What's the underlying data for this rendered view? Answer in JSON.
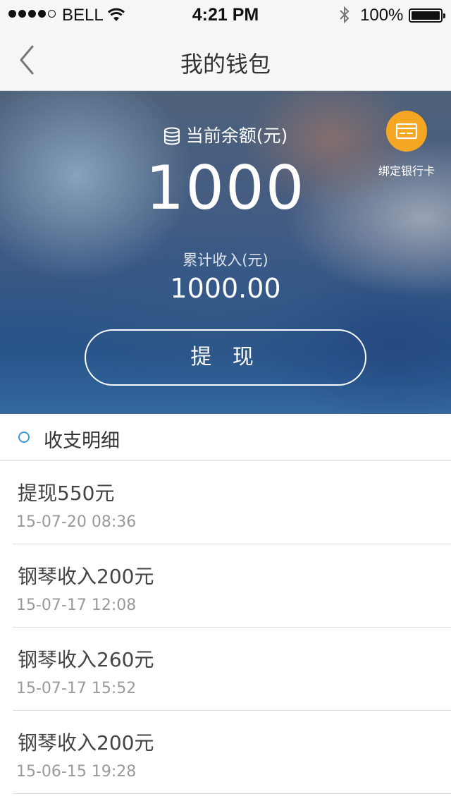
{
  "status_bar": {
    "carrier": "BELL",
    "time": "4:21 PM",
    "battery": "100%"
  },
  "nav": {
    "title": "我的钱包"
  },
  "wallet": {
    "balance_label": "当前余额(元)",
    "balance": "1000",
    "income_label": "累计收入(元)",
    "income": "1000.00",
    "withdraw_label": "提 现",
    "bind_card_label": "绑定银行卡",
    "accent_color": "#f5a623"
  },
  "details": {
    "header": "收支明细",
    "items": [
      {
        "title": "提现550元",
        "time": "15-07-20  08:36"
      },
      {
        "title": "钢琴收入200元",
        "time": "15-07-17  12:08"
      },
      {
        "title": "钢琴收入260元",
        "time": "15-07-17  15:52"
      },
      {
        "title": "钢琴收入200元",
        "time": "15-06-15  19:28"
      }
    ]
  }
}
